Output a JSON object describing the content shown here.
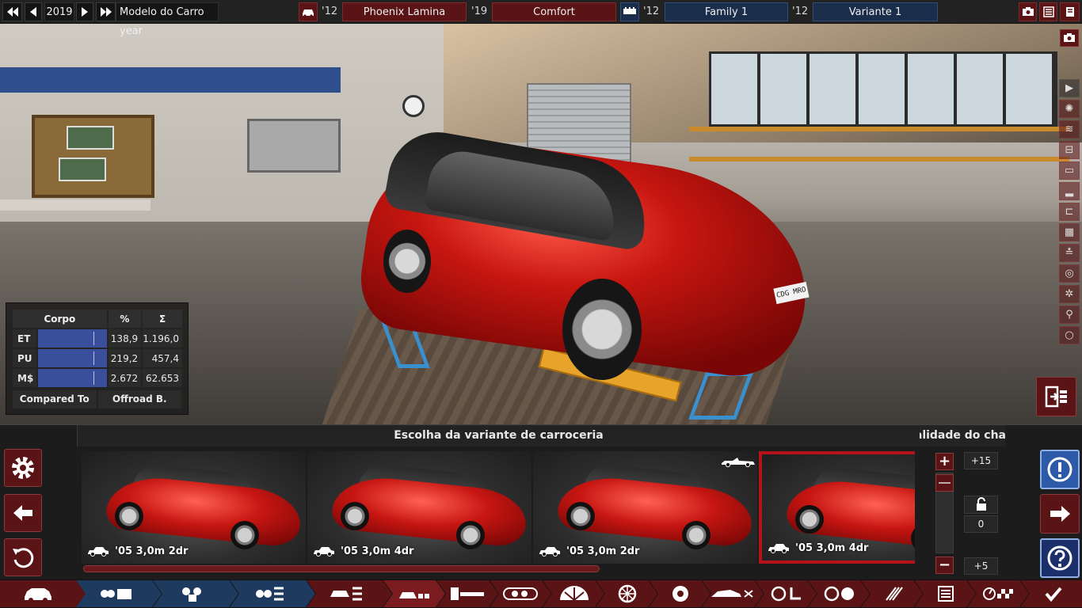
{
  "topbar": {
    "year": "2019",
    "model_label": "Modelo do Carro year",
    "model_year": "'12",
    "model_name": "Phoenix Lamina",
    "trim_year": "'19",
    "trim_name": "Comfort",
    "family_year": "'12",
    "family_name": "Family 1",
    "variant_year": "'12",
    "variant_name": "Variante 1"
  },
  "scene": {
    "plate_text": "CDG MRO"
  },
  "stats": {
    "headers": [
      "Corpo",
      "%",
      "Σ"
    ],
    "rows": [
      {
        "label": "ET",
        "bar_level": 0.81,
        "percent": "138,9",
        "sum": "1.196,0"
      },
      {
        "label": "PU",
        "bar_level": 0.81,
        "percent": "219,2",
        "sum": "457,4"
      },
      {
        "label": "M$",
        "bar_level": 0.81,
        "percent": "2.672",
        "sum": "62.653"
      }
    ],
    "compared_to_label": "Compared To",
    "compared_to_value": "Offroad B."
  },
  "selection": {
    "title": "Escolha da variante de carroceria",
    "quality_title": "Qualidade do chassi",
    "cards": [
      {
        "label": "'05 3,0m 2dr",
        "selected": false
      },
      {
        "label": "'05 3,0m 4dr",
        "selected": false
      },
      {
        "label": "'05 3,0m 2dr",
        "selected": false
      },
      {
        "label": "'05 3,0m 4dr",
        "selected": true
      }
    ],
    "scroll_fraction": 0.62
  },
  "quality": {
    "max_label": "+15",
    "current_value": "0",
    "min_label": "+5"
  },
  "colors": {
    "accent_red": "#5a1416",
    "selected_border": "#b5121b",
    "accent_blue": "#1a2d4a",
    "stat_bar": "#3a4f9b",
    "help_blue": "#1b2f6b"
  },
  "icons": {
    "right_column": [
      "play-icon",
      "wheel-icon",
      "spring-icon",
      "engine-icon",
      "gearbox-icon",
      "car-side-icon",
      "seat-belt-icon",
      "fuel-icon",
      "road-icon",
      "speed-icon",
      "gear-icon",
      "walk-icon",
      "circle-icon"
    ],
    "nav": [
      "car-icon",
      "model-folder-icon",
      "trim-icon",
      "family-icon",
      "variant-icon",
      "chassis-icon",
      "suspension-icon",
      "brakes-icon",
      "tyre-icon",
      "rim-icon",
      "aero-icon",
      "fan-icon",
      "interior-icon",
      "steering-icon",
      "drivetrain-icon",
      "list-icon",
      "speedometer-icon",
      "checkmark-icon"
    ]
  }
}
